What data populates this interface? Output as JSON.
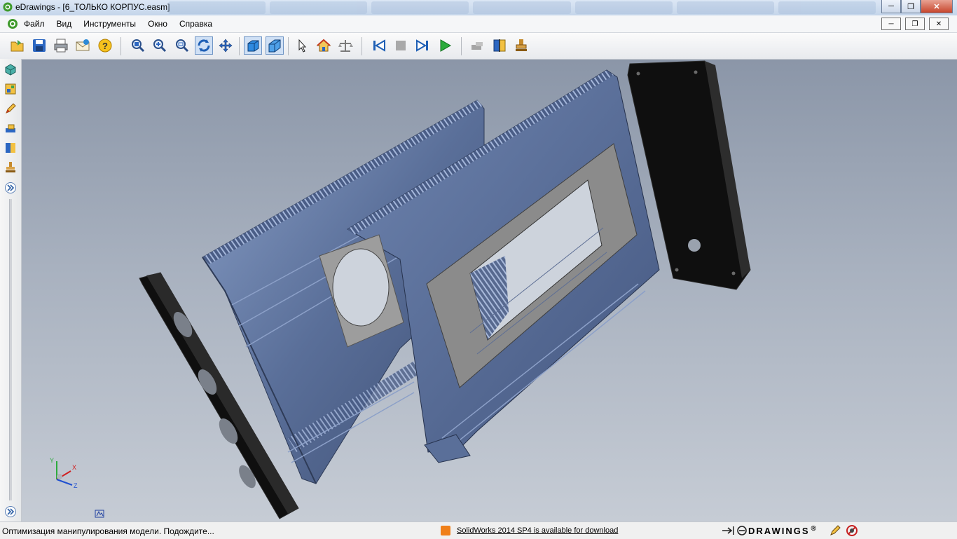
{
  "window": {
    "title": "eDrawings - [6_ТОЛЬКО КОРПУС.easm]",
    "minimize": "─",
    "maximize": "❐",
    "close": "✕"
  },
  "menu": {
    "items": [
      "Файл",
      "Вид",
      "Инструменты",
      "Окно",
      "Справка"
    ],
    "mdi_minimize": "─",
    "mdi_restore": "❐",
    "mdi_close": "✕"
  },
  "toolbar": {
    "buttons": [
      "open-icon",
      "save-icon",
      "print-icon",
      "send-icon",
      "help-icon",
      "zoom-to-fit-icon",
      "zoom-in-out-icon",
      "zoom-to-area-icon",
      "rotate-icon",
      "pan-icon",
      "shaded-view-icon",
      "perspective-icon",
      "select-icon",
      "home-icon",
      "measure-icon",
      "previous-icon",
      "stop-icon",
      "next-icon",
      "play-icon",
      "markup-icon",
      "section-icon",
      "stamp-icon"
    ]
  },
  "sidebar": {
    "buttons": [
      "components-icon",
      "configurations-icon",
      "markup-icon",
      "measure-icon",
      "section-icon",
      "stamp-icon",
      "expand-icon"
    ]
  },
  "statusbar": {
    "message": "Оптимизация манипулирования модели. Подождите...",
    "update_link": "SolidWorks 2014 SP4 is available for download",
    "brand": "DRAWINGS",
    "brand_mark": "®"
  },
  "triad": {
    "x": "X",
    "y": "Y",
    "z": "Z"
  },
  "colors": {
    "housing": "#4a5d86",
    "housing_light": "#7b8fb9",
    "cover": "#141414",
    "window_frame": "#8b8b8b",
    "background_top": "#8b96a8",
    "background_bottom": "#c6ccd5"
  }
}
